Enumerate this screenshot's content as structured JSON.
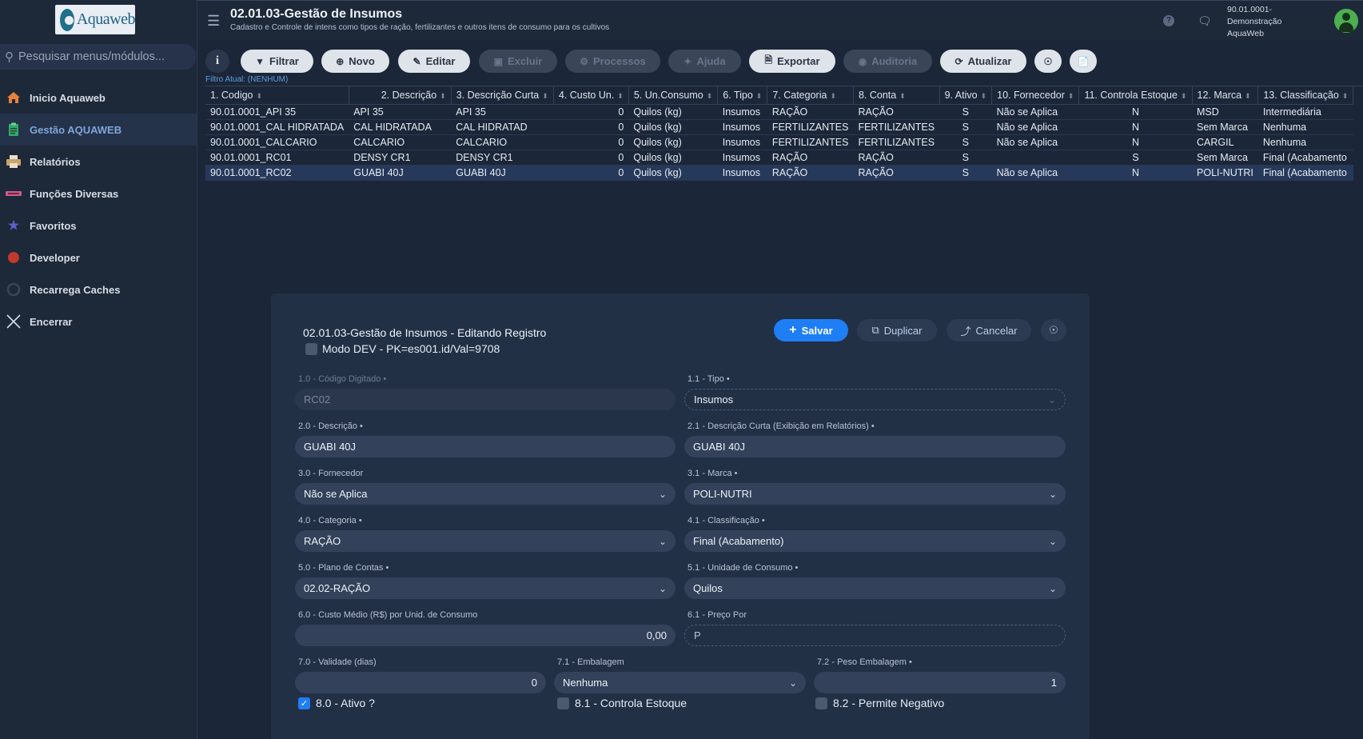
{
  "sidebar": {
    "logo_text": "Aquaweb",
    "search_placeholder": "Pesquisar menus/módulos...",
    "items": [
      {
        "label": "Inicio Aquaweb",
        "icon": "home-icon",
        "color": "#e8823a"
      },
      {
        "label": "Gestão AQUAWEB",
        "icon": "clipboard-icon",
        "color": "#35a86a"
      },
      {
        "label": "Relatórios",
        "icon": "printer-icon",
        "color": "#c9a46b"
      },
      {
        "label": "Funções Diversas",
        "icon": "tools-icon",
        "color": "#d25a8a"
      },
      {
        "label": "Favoritos",
        "icon": "star-icon",
        "color": "#5b5fc4"
      },
      {
        "label": "Developer",
        "icon": "developer-icon",
        "color": "#c0392b"
      },
      {
        "label": "Recarrega Caches",
        "icon": "refresh-icon",
        "color": "#3a4556"
      },
      {
        "label": "Encerrar",
        "icon": "close-icon",
        "color": "#d7dde6"
      }
    ]
  },
  "header": {
    "title": "02.01.03-Gestão de Insumos",
    "subtitle": "Cadastro e Controle de intens como tipos de ração, fertilizantes e outros itens de consumo para os cultivos",
    "user_line1": "90.01.0001-",
    "user_line2": "Demonstração",
    "user_line3": "AquaWeb"
  },
  "toolbar": {
    "info": "i",
    "filter": "Filtrar",
    "new": "Novo",
    "edit": "Editar",
    "delete": "Excluir",
    "processes": "Processos",
    "help": "Ajuda",
    "export": "Exportar",
    "audit": "Auditoria",
    "refresh": "Atualizar",
    "filter_status": "Filtro Atual: (NENHUM)"
  },
  "grid": {
    "columns": [
      "1. Codigo",
      "2. Descrição",
      "3. Descrição Curta",
      "4. Custo Un.",
      "5. Un.Consumo",
      "6. Tipo",
      "7. Categoria",
      "8. Conta",
      "9. Ativo",
      "10. Fornecedor",
      "11. Controla Estoque",
      "12. Marca",
      "13. Classificação"
    ],
    "rows": [
      [
        "90.01.0001_API 35",
        "API 35",
        "API 35",
        "0",
        "Quilos (kg)",
        "Insumos",
        "RAÇÃO",
        "RAÇÃO",
        "S",
        "Não se Aplica",
        "N",
        "MSD",
        "Intermediária"
      ],
      [
        "90.01.0001_CAL HIDRATADA",
        "CAL HIDRATADA",
        "CAL HIDRATAD",
        "0",
        "Quilos (kg)",
        "Insumos",
        "FERTILIZANTES",
        "FERTILIZANTES",
        "S",
        "Não se Aplica",
        "N",
        "Sem Marca",
        "Nenhuma"
      ],
      [
        "90.01.0001_CALCARIO",
        "CALCARIO",
        "CALCARIO",
        "0",
        "Quilos (kg)",
        "Insumos",
        "FERTILIZANTES",
        "FERTILIZANTES",
        "S",
        "Não se Aplica",
        "N",
        "CARGIL",
        "Nenhuma"
      ],
      [
        "90.01.0001_RC01",
        "DENSY CR1",
        "DENSY CR1",
        "0",
        "Quilos (kg)",
        "Insumos",
        "RAÇÃO",
        "RAÇÃO",
        "S",
        "",
        "S",
        "Sem Marca",
        "Final (Acabamento"
      ],
      [
        "90.01.0001_RC02",
        "GUABI 40J",
        "GUABI 40J",
        "0",
        "Quilos (kg)",
        "Insumos",
        "RAÇÃO",
        "RAÇÃO",
        "S",
        "Não se Aplica",
        "N",
        "POLI-NUTRI",
        "Final (Acabamento"
      ]
    ]
  },
  "modal": {
    "title": "02.01.03-Gestão de Insumos - Editando Registro",
    "devmode": "Modo DEV - PK=es001.id/Val=9708",
    "save": "Salvar",
    "duplicate": "Duplicar",
    "cancel": "Cancelar",
    "fields": {
      "codigo": {
        "label": "1.0 - Código Digitado •",
        "value": "RC02"
      },
      "tipo": {
        "label": "1.1 - Tipo •",
        "value": "Insumos"
      },
      "descricao": {
        "label": "2.0 - Descrição •",
        "value": "GUABI 40J"
      },
      "descricao_curta": {
        "label": "2.1 - Descrição Curta (Exibição em Relatórios) •",
        "value": "GUABI 40J"
      },
      "fornecedor": {
        "label": "3.0 - Fornecedor",
        "value": "Não se Aplica"
      },
      "marca": {
        "label": "3.1 - Marca •",
        "value": "POLI-NUTRI"
      },
      "categoria": {
        "label": "4.0 - Categoria •",
        "value": "RAÇÃO"
      },
      "classificacao": {
        "label": "4.1 - Classificação •",
        "value": "Final (Acabamento)"
      },
      "plano_contas": {
        "label": "5.0 - Plano de Contas •",
        "value": "02.02-RAÇÃO"
      },
      "unidade_consumo": {
        "label": "5.1 - Unidade de Consumo •",
        "value": "Quilos"
      },
      "custo_medio": {
        "label": "6.0 - Custo Médio (R$) por Unid. de Consumo",
        "value": "0,00"
      },
      "preco_por": {
        "label": "6.1 - Preço Por",
        "value": "P"
      },
      "validade": {
        "label": "7.0 - Validade (dias)",
        "value": "0"
      },
      "embalagem": {
        "label": "7.1 - Embalagem",
        "value": "Nenhuma"
      },
      "peso_embalagem": {
        "label": "7.2 - Peso Embalagem •",
        "value": "1"
      }
    },
    "checks": {
      "ativo": {
        "label": "8.0 - Ativo ?",
        "checked": true
      },
      "controla_estoque": {
        "label": "8.1 - Controla Estoque",
        "checked": false
      },
      "permite_negativo": {
        "label": "8.2 - Permite Negativo",
        "checked": false
      }
    }
  },
  "colors": {
    "background": "#1b2638",
    "accent": "#1e7ef5",
    "avatar": "#4caf50"
  }
}
